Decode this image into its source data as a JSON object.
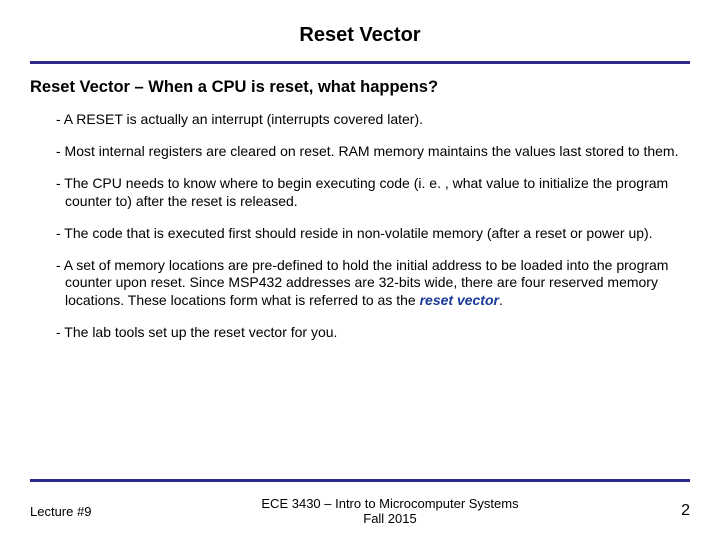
{
  "title": "Reset Vector",
  "subheading": "Reset Vector – When a CPU is reset, what happens?",
  "bullets": {
    "b1": "- A RESET is actually an interrupt (interrupts covered later).",
    "b2": "- Most internal registers are cleared on reset.  RAM memory maintains the values last stored to them.",
    "b3": "- The CPU needs to know where to begin executing code (i. e. , what value to initialize the program counter to) after the reset is released.",
    "b4": "- The code that is executed first should reside in non-volatile memory (after a reset or power up).",
    "b5_pre": "- A set of memory locations are pre-defined to hold the initial address to be loaded into the program counter upon reset.  Since MSP432 addresses are 32-bits wide, there are four reserved memory locations.  These locations form what is referred to as the ",
    "b5_term": "reset vector",
    "b5_post": ".",
    "b6": "- The lab tools set up the reset vector for you."
  },
  "footer": {
    "left": "Lecture #9",
    "center_line1": "ECE 3430 – Intro to Microcomputer Systems",
    "center_line2": "Fall 2015",
    "page": "2"
  }
}
